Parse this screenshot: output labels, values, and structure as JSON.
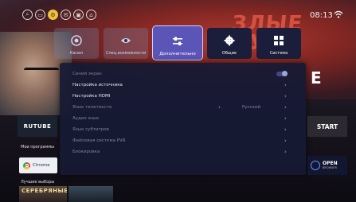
{
  "status": {
    "time": "08:13"
  },
  "background": {
    "poster_title": "ЗЛЫЕ ДУХИ",
    "brand_letter": "E"
  },
  "tabs": [
    {
      "label": "Канал",
      "icon": "channel-icon"
    },
    {
      "label": "Спец.возможности",
      "icon": "eye-icon"
    },
    {
      "label": "Дополнительно",
      "icon": "sliders-icon",
      "active": true
    },
    {
      "label": "Общие",
      "icon": "gear-icon"
    },
    {
      "label": "Система",
      "icon": "grid-icon"
    }
  ],
  "menu": [
    {
      "label": "Синий экран",
      "type": "toggle",
      "enabled": false,
      "value_on": true
    },
    {
      "label": "Настройка источника",
      "type": "nav",
      "enabled": true
    },
    {
      "label": "Настройка HDMI",
      "type": "nav",
      "enabled": true
    },
    {
      "label": "Язык телетекста",
      "type": "select",
      "enabled": false,
      "value": "Русский"
    },
    {
      "label": "Аудио язык",
      "type": "nav",
      "enabled": false
    },
    {
      "label": "Язык субтитров",
      "type": "nav",
      "enabled": false
    },
    {
      "label": "Файловая система PVR",
      "type": "nav",
      "enabled": false
    },
    {
      "label": "Блокировка",
      "type": "nav",
      "enabled": false
    }
  ],
  "home": {
    "rutube_label": "RUTUBE",
    "start_label": "START",
    "my_apps_label": "Мои программы",
    "chrome_label": "Chrome",
    "open_browser_label1": "OPEN",
    "open_browser_label2": "BROWSER",
    "best_picks_label": "Лучшие выборы",
    "bottom_poster_title": "СЕРЕБРЯНЫЕ"
  }
}
